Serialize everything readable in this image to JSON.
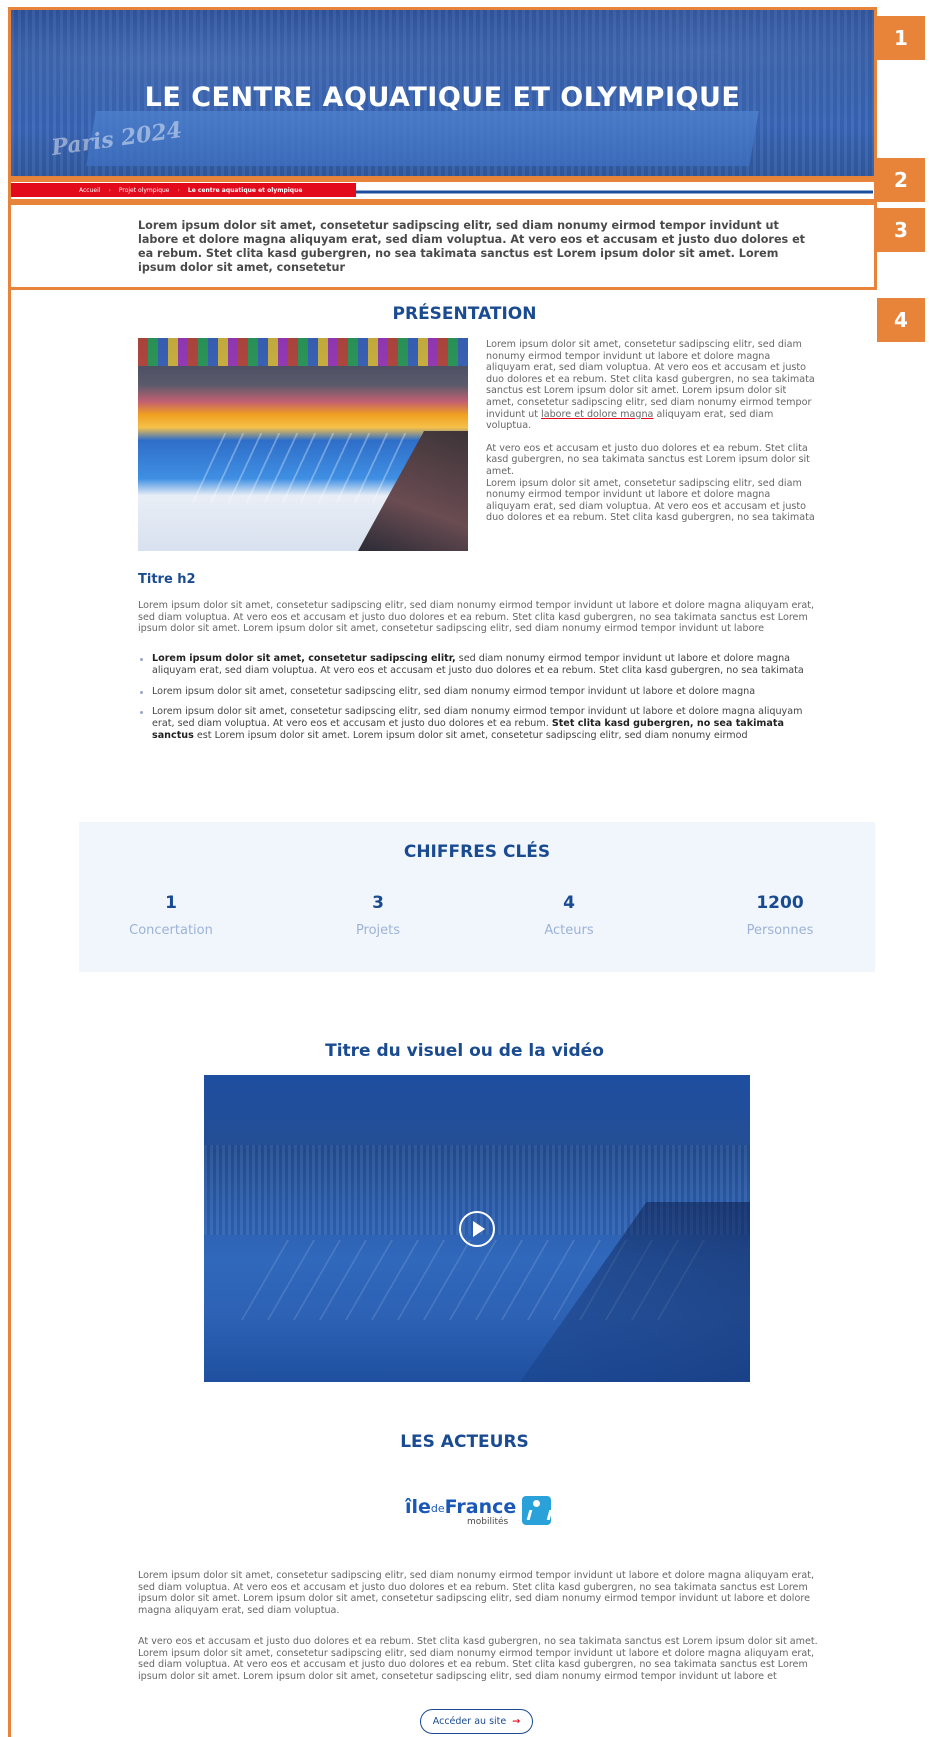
{
  "hero": {
    "title": "LE CENTRE AQUATIQUE ET OLYMPIQUE",
    "watermark": "Paris 2024"
  },
  "breadcrumb": {
    "home": "Accueil",
    "parent": "Projet olympique",
    "current": "Le centre aquatique et olympique"
  },
  "annotations": [
    "1",
    "2",
    "3",
    "4"
  ],
  "intro": "Lorem ipsum dolor sit amet, consetetur sadipscing elitr, sed diam nonumy eirmod tempor invidunt ut labore et dolore magna aliquyam erat, sed diam voluptua. At vero eos et accusam et justo duo dolores et ea rebum. Stet clita kasd gubergren, no sea takimata sanctus est Lorem ipsum dolor sit amet. Lorem ipsum dolor sit amet, consetetur",
  "presentation": {
    "title": "PRÉSENTATION",
    "p1a": "Lorem ipsum dolor sit amet, consetetur sadipscing elitr, sed diam nonumy eirmod tempor invidunt ut labore et dolore magna aliquyam erat, sed diam voluptua. At vero eos et accusam et justo duo dolores et ea rebum. Stet clita kasd gubergren, no sea takimata sanctus est Lorem ipsum dolor sit amet. Lorem ipsum dolor sit amet, consetetur sadipscing elitr, sed diam nonumy eirmod tempor invidunt ut ",
    "p1_link": "labore et dolore magna",
    "p1b": " aliquyam erat, sed diam voluptua.",
    "p2": "At vero eos et accusam et justo duo dolores et ea rebum. Stet clita kasd gubergren, no sea takimata sanctus est Lorem ipsum dolor sit amet.",
    "p3": "Lorem ipsum dolor sit amet, consetetur sadipscing elitr, sed diam nonumy eirmod tempor invidunt ut labore et dolore magna aliquyam erat, sed diam voluptua. At vero eos et accusam et justo duo dolores et ea rebum. Stet clita kasd gubergren, no sea takimata"
  },
  "section_h2": {
    "title": "Titre h2",
    "body": "Lorem ipsum dolor sit amet, consetetur sadipscing elitr, sed diam nonumy eirmod tempor invidunt ut labore et dolore magna aliquyam erat, sed diam voluptua. At vero eos et accusam et justo duo dolores et ea rebum. Stet clita kasd gubergren, no sea takimata sanctus est Lorem ipsum dolor sit amet. Lorem ipsum dolor sit amet, consetetur sadipscing elitr, sed diam nonumy eirmod tempor invidunt ut labore",
    "bullet1_bold": "Lorem ipsum dolor sit amet, consetetur sadipscing elitr,",
    "bullet1_rest": " sed diam nonumy eirmod tempor invidunt ut labore et dolore magna aliquyam erat, sed diam voluptua. At vero eos et accusam et justo duo dolores et ea rebum. Stet clita kasd gubergren, no sea takimata",
    "bullet2": "Lorem ipsum dolor sit amet, consetetur sadipscing elitr, sed diam nonumy eirmod tempor invidunt ut labore et dolore magna",
    "bullet3_a": "Lorem ipsum dolor sit amet, consetetur sadipscing elitr, sed diam nonumy eirmod tempor invidunt ut labore et dolore magna aliquyam erat, sed diam voluptua. At vero eos et accusam et justo duo dolores et ea rebum. ",
    "bullet3_bold": "Stet clita kasd gubergren, no sea takimata sanctus",
    "bullet3_b": " est Lorem ipsum dolor sit amet. Lorem ipsum dolor sit amet, consetetur sadipscing elitr, sed diam nonumy eirmod"
  },
  "key_figures": {
    "title": "CHIFFRES CLÉS",
    "items": [
      {
        "value": "1",
        "label": "Concertation"
      },
      {
        "value": "3",
        "label": "Projets"
      },
      {
        "value": "4",
        "label": "Acteurs"
      },
      {
        "value": "1200",
        "label": "Personnes"
      }
    ]
  },
  "video": {
    "title": "Titre du visuel ou de la vidéo"
  },
  "actors": {
    "title": "LES ACTEURS",
    "logo_ile": "île",
    "logo_de": "de",
    "logo_france": "France",
    "logo_sub": "mobilités",
    "p1": "Lorem ipsum dolor sit amet, consetetur sadipscing elitr, sed diam nonumy eirmod tempor invidunt ut labore et dolore magna aliquyam erat, sed diam voluptua. At vero eos et accusam et justo duo dolores et ea rebum. Stet clita kasd gubergren, no sea takimata sanctus est Lorem ipsum dolor sit amet. Lorem ipsum dolor sit amet, consetetur sadipscing elitr, sed diam nonumy eirmod tempor invidunt ut labore et dolore magna aliquyam erat, sed diam voluptua.",
    "p2": "At vero eos et accusam et justo duo dolores et ea rebum. Stet clita kasd gubergren, no sea takimata sanctus est Lorem ipsum dolor sit amet. Lorem ipsum dolor sit amet, consetetur sadipscing elitr, sed diam nonumy eirmod tempor invidunt ut labore et dolore magna aliquyam erat, sed diam voluptua. At vero eos et accusam et justo duo dolores et ea rebum. Stet clita kasd gubergren, no sea takimata sanctus est Lorem ipsum dolor sit amet. Lorem ipsum dolor sit amet, consetetur sadipscing elitr, sed diam nonumy eirmod tempor invidunt ut labore et",
    "cta": "Accéder au site",
    "cta_arrow": "→"
  },
  "colors": {
    "annotation": "#e8843a",
    "primary": "#1a4b91",
    "accent_red": "#e30a1c",
    "figures_bg": "#f1f6fd"
  }
}
